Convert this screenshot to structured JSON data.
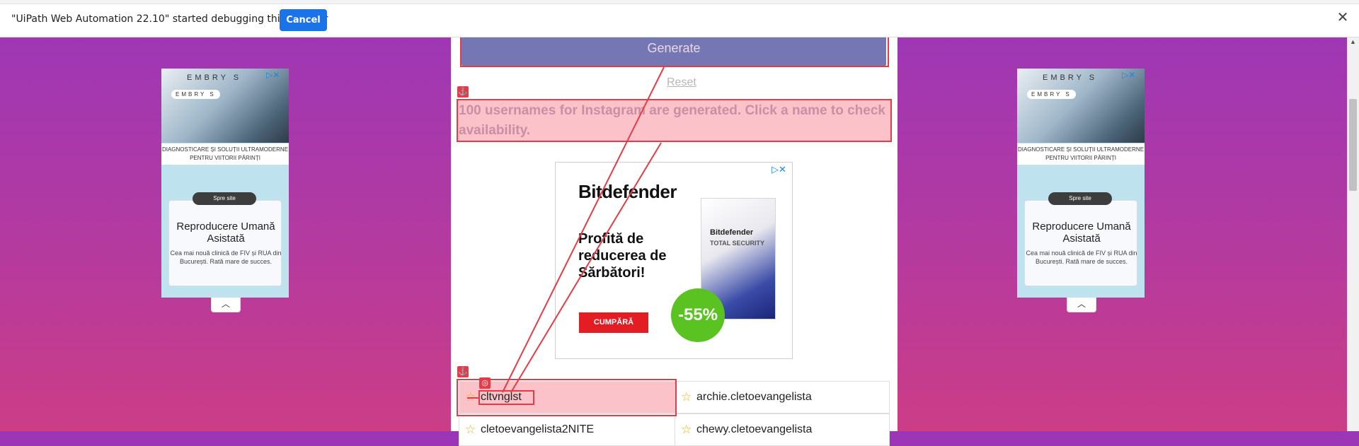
{
  "infobar": {
    "message": "\"UiPath Web Automation 22.10\" started debugging this browser",
    "cancel_label": "Cancel",
    "close_glyph": "✕"
  },
  "main": {
    "generate_label": "Generate",
    "reset_label": "Reset",
    "heading": "100 usernames for Instagram are generated. Click a name to check availability."
  },
  "center_ad": {
    "brand": "Bitdefender",
    "headline": "Profită de reducerea de Sărbători!",
    "cta": "CUMPĂRĂ",
    "discount": "-55%",
    "box_brand": "Bitdefender",
    "box_sub": "TOTAL SECURITY",
    "adchoices": "▷✕"
  },
  "side_ad": {
    "logo": "EMBRY S",
    "logo_small": "EMBRY S",
    "caption": "DIAGNOSTICARE ȘI SOLUȚII ULTRAMODERNE PENTRU VIITORII PĂRINȚI",
    "pill": "Spre site",
    "title": "Reproducere Umană Asistată",
    "body": "Cea mai nouă clinică de FIV și RUA din București. Rată mare de succes.",
    "adchoices": "▷✕",
    "collapse_glyph": "︿"
  },
  "usernames": [
    {
      "name": "cltvnglst"
    },
    {
      "name": "archie.cletoevangelista"
    },
    {
      "name": "cletoevangelista2NITE"
    },
    {
      "name": "chewy.cletoevangelista"
    }
  ],
  "icons": {
    "star": "☆",
    "anchor": "⚓",
    "target": "◎"
  },
  "colors": {
    "overlay_red": "#e53b46",
    "highlight_fill": "#fbc3c9",
    "generate_bg": "#7477b4",
    "cancel_bg": "#1a73e8",
    "star": "#f0b326"
  }
}
